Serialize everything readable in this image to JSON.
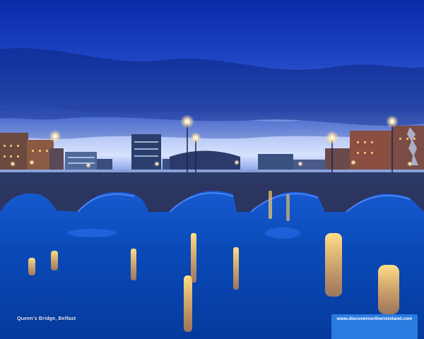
{
  "caption": {
    "location": "Queen's Bridge, Belfast"
  },
  "branding": {
    "url": "www.discovernorthernireland.com"
  },
  "colors": {
    "sky_top": "#0b2fb0",
    "sky_mid": "#2a4fc8",
    "horizon": "#c9d8ff",
    "water": "#0a4ec8",
    "lamp_glow": "#ffd27a",
    "bridge_stone": "#2b3a66",
    "brand_box": "#2a7be0"
  }
}
